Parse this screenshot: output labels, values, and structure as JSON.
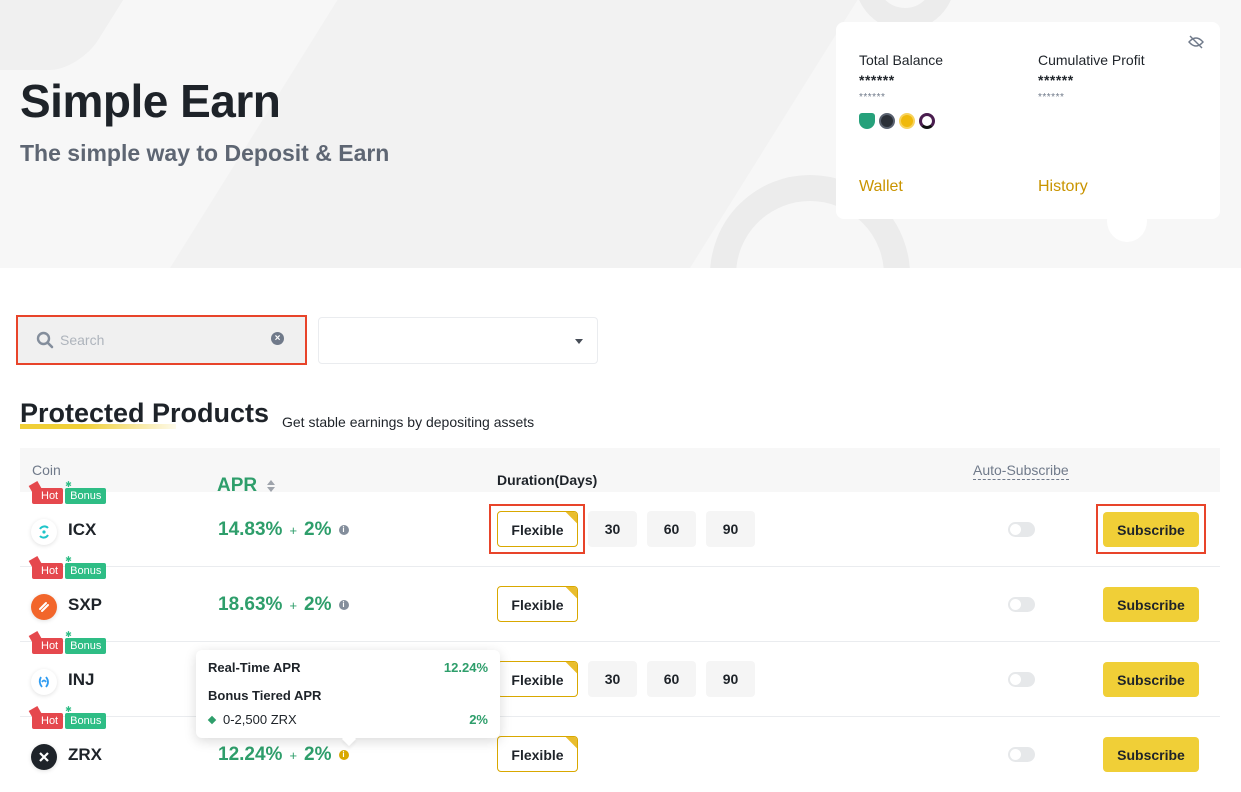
{
  "hero": {
    "title": "Simple Earn",
    "subtitle": "The simple way to Deposit & Earn"
  },
  "balance_card": {
    "total_balance_label": "Total Balance",
    "total_balance_value": "******",
    "total_balance_sub": "******",
    "cumulative_profit_label": "Cumulative Profit",
    "cumulative_profit_value": "******",
    "cumulative_profit_sub": "******",
    "coin_icons": [
      "usdt-icon",
      "aave-icon",
      "bnb-icon",
      "dot-icon"
    ],
    "wallet_link": "Wallet",
    "history_link": "History",
    "visibility_icon": "eye-off-icon"
  },
  "search": {
    "placeholder": "Search",
    "value": ""
  },
  "filter": {
    "selected": ""
  },
  "section": {
    "title": "Protected Products",
    "subtitle": "Get stable earnings by depositing assets"
  },
  "table": {
    "headers": {
      "coin": "Coin",
      "apr": "APR",
      "duration": "Duration(Days)",
      "auto_subscribe": "Auto-Subscribe"
    },
    "rows": [
      {
        "coin": "ICX",
        "tags": [
          "Hot",
          "Bonus"
        ],
        "apr": "14.83%",
        "plus": "+",
        "bonus_apr": "2%",
        "durations": [
          "Flexible",
          "30",
          "60",
          "90"
        ],
        "selected_duration": "Flexible",
        "auto_subscribe": false,
        "action": "Subscribe"
      },
      {
        "coin": "SXP",
        "tags": [
          "Hot",
          "Bonus"
        ],
        "apr": "18.63%",
        "plus": "+",
        "bonus_apr": "2%",
        "durations": [
          "Flexible"
        ],
        "selected_duration": "Flexible",
        "auto_subscribe": false,
        "action": "Subscribe"
      },
      {
        "coin": "INJ",
        "tags": [
          "Hot",
          "Bonus"
        ],
        "apr": "",
        "plus": "",
        "bonus_apr": "",
        "durations": [
          "Flexible",
          "30",
          "60",
          "90"
        ],
        "selected_duration": "Flexible",
        "auto_subscribe": false,
        "action": "Subscribe"
      },
      {
        "coin": "ZRX",
        "tags": [
          "Hot",
          "Bonus"
        ],
        "apr": "12.24%",
        "plus": "+",
        "bonus_apr": "2%",
        "durations": [
          "Flexible"
        ],
        "selected_duration": "Flexible",
        "auto_subscribe": false,
        "action": "Subscribe"
      }
    ]
  },
  "tooltip": {
    "realtime_label": "Real-Time APR",
    "realtime_value": "12.24%",
    "bonus_label": "Bonus Tiered APR",
    "tier_label": "0-2,500 ZRX",
    "tier_value": "2%"
  },
  "colors": {
    "accent": "#f0cf37",
    "link": "#c99400",
    "positive": "#2e9e6b",
    "hot_tag": "#e5484d",
    "bonus_tag": "#2ebd85",
    "highlight_outline": "#e8442a"
  }
}
